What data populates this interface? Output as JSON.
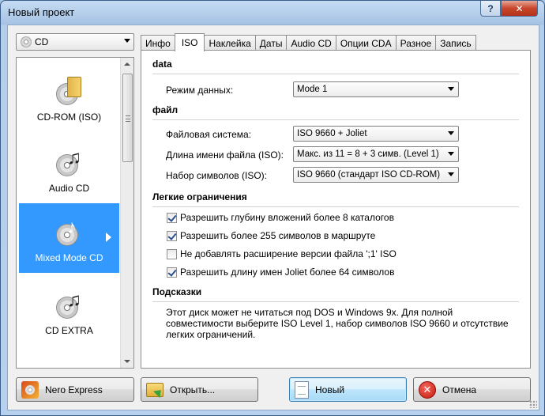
{
  "window": {
    "title": "Новый проект",
    "help_glyph": "?",
    "close_glyph": "✕"
  },
  "media_combo": {
    "value": "CD"
  },
  "project_types": [
    {
      "label": "CD-ROM (ISO)",
      "icon": "cd-folder-icon",
      "selected": false
    },
    {
      "label": "Audio CD",
      "icon": "cd-music-icon",
      "selected": false
    },
    {
      "label": "Mixed Mode CD",
      "icon": "cd-mixed-icon",
      "selected": true
    },
    {
      "label": "CD EXTRA",
      "icon": "cd-extra-icon",
      "selected": false
    }
  ],
  "tabs": [
    "Инфо",
    "ISO",
    "Наклейка",
    "Даты",
    "Audio CD",
    "Опции CDA",
    "Разное",
    "Запись"
  ],
  "active_tab": "ISO",
  "sections": {
    "data": {
      "title": "data",
      "mode_label": "Режим данных:",
      "mode_value": "Mode 1"
    },
    "file": {
      "title": "файл",
      "fs_label": "Файловая система:",
      "fs_value": "ISO 9660 + Joliet",
      "namelen_label": "Длина имени файла (ISO):",
      "namelen_value": "Макс. из 11 = 8 + 3 симв. (Level 1)",
      "charset_label": "Набор символов (ISO):",
      "charset_value": "ISO 9660 (стандарт ISO CD-ROM)"
    },
    "relax": {
      "title": "Легкие ограничения",
      "options": [
        {
          "label": "Разрешить глубину вложений более 8 каталогов",
          "checked": true
        },
        {
          "label": "Разрешить более 255 символов в маршруте",
          "checked": true
        },
        {
          "label": "Не добавлять расширение версии файла ';1' ISO",
          "checked": false
        },
        {
          "label": "Разрешить длину имен Joliet более 64 символов",
          "checked": true
        }
      ]
    },
    "hints": {
      "title": "Подсказки",
      "text": "Этот диск может не читаться под DOS и Windows 9x. Для полной совместимости выберите ISO Level 1, набор символов ISO 9660 и отсутствие легких ограничений."
    }
  },
  "buttons": {
    "nero_express": "Nero Express",
    "open": "Открыть...",
    "new": "Новый",
    "cancel": "Отмена"
  }
}
